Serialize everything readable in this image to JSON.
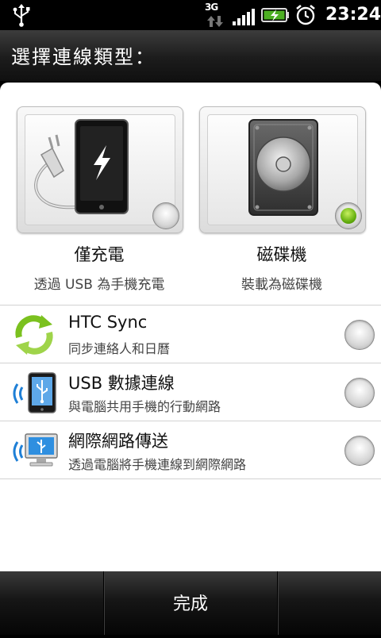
{
  "status_bar": {
    "network_type": "3G",
    "time": "23:24",
    "icons": [
      "usb-icon",
      "data-arrows-icon",
      "signal-icon",
      "battery-charging-icon",
      "alarm-icon"
    ],
    "battery_color": "#4caf22"
  },
  "dialog": {
    "title": "選擇連線類型："
  },
  "cards": [
    {
      "title": "僅充電",
      "subtitle": "透過 USB 為手機充電",
      "icon": "phone-charging-icon",
      "selected": false
    },
    {
      "title": "磁碟機",
      "subtitle": "裝載為磁碟機",
      "icon": "disk-drive-icon",
      "selected": true
    }
  ],
  "options": [
    {
      "title": "HTC Sync",
      "subtitle": "同步連絡人和日曆",
      "icon": "sync-arrows-icon",
      "selected": false
    },
    {
      "title": "USB 數據連線",
      "subtitle": "與電腦共用手機的行動網路",
      "icon": "usb-tethering-icon",
      "selected": false
    },
    {
      "title": "網際網路傳送",
      "subtitle": "透過電腦將手機連線到網際網路",
      "icon": "internet-pass-through-icon",
      "selected": false
    }
  ],
  "bottom_bar": {
    "done_label": "完成"
  },
  "colors": {
    "selected_radio": "#66b010",
    "accent_blue": "#1e7fd6"
  }
}
